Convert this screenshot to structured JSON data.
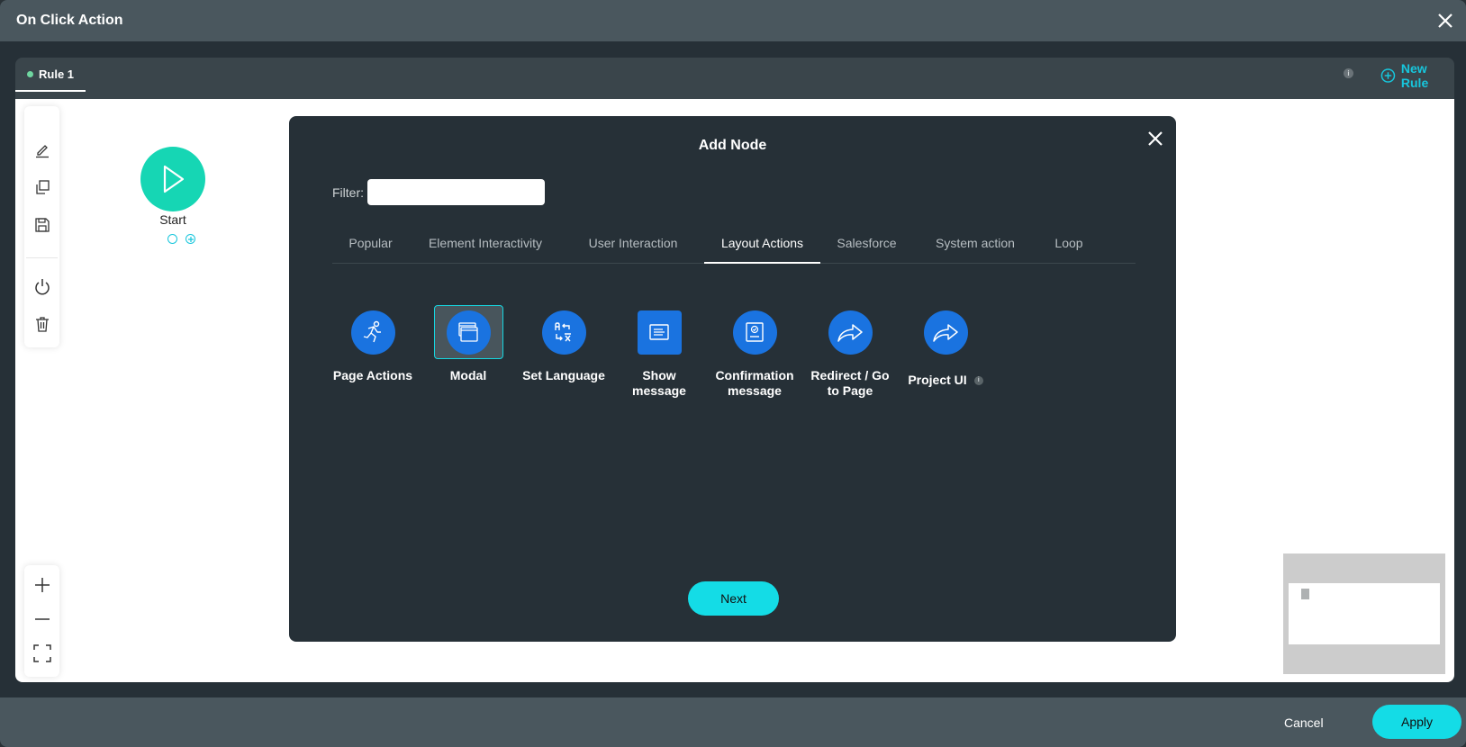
{
  "window": {
    "title": "On Click Action",
    "close_icon": "close-icon"
  },
  "rules": {
    "tabs": [
      {
        "label": "Rule 1",
        "status_color": "#6fd6a0",
        "active": true
      }
    ],
    "info_icon": "info-icon",
    "new_rule_label": "New Rule"
  },
  "toolbar": {
    "items": [
      {
        "icon": "pencil-icon",
        "name": "edit"
      },
      {
        "icon": "copy-icon",
        "name": "duplicate"
      },
      {
        "icon": "save-icon",
        "name": "save"
      },
      {
        "icon": "power-icon",
        "name": "toggle"
      },
      {
        "icon": "trash-icon",
        "name": "delete"
      }
    ],
    "zoom": [
      {
        "icon": "plus-icon",
        "name": "zoom-in"
      },
      {
        "icon": "minus-icon",
        "name": "zoom-out"
      },
      {
        "icon": "fit-screen-icon",
        "name": "fit"
      }
    ]
  },
  "canvas": {
    "start_node": {
      "label": "Start",
      "color": "#16d6b4"
    }
  },
  "add_node": {
    "title": "Add Node",
    "filter_label": "Filter:",
    "filter_value": "",
    "tabs": [
      {
        "label": "Popular"
      },
      {
        "label": "Element Interactivity"
      },
      {
        "label": "User Interaction"
      },
      {
        "label": "Layout Actions",
        "active": true
      },
      {
        "label": "Salesforce"
      },
      {
        "label": "System action"
      },
      {
        "label": "Loop"
      }
    ],
    "nodes": [
      {
        "label": "Page Actions",
        "icon": "running-person-icon"
      },
      {
        "label": "Modal",
        "icon": "windows-icon",
        "selected": true
      },
      {
        "label": "Set Language",
        "icon": "translate-icon"
      },
      {
        "label": "Show message",
        "icon": "message-icon"
      },
      {
        "label": "Confirmation message",
        "icon": "confirmation-icon"
      },
      {
        "label": "Redirect / Go to Page",
        "icon": "redirect-arrow-icon"
      },
      {
        "label": "Project UI",
        "icon": "share-arrow-icon",
        "has_info": true
      }
    ],
    "next_label": "Next",
    "accent": "#1a73e0"
  },
  "footer": {
    "cancel_label": "Cancel",
    "apply_label": "Apply",
    "accent": "#14dce6"
  }
}
